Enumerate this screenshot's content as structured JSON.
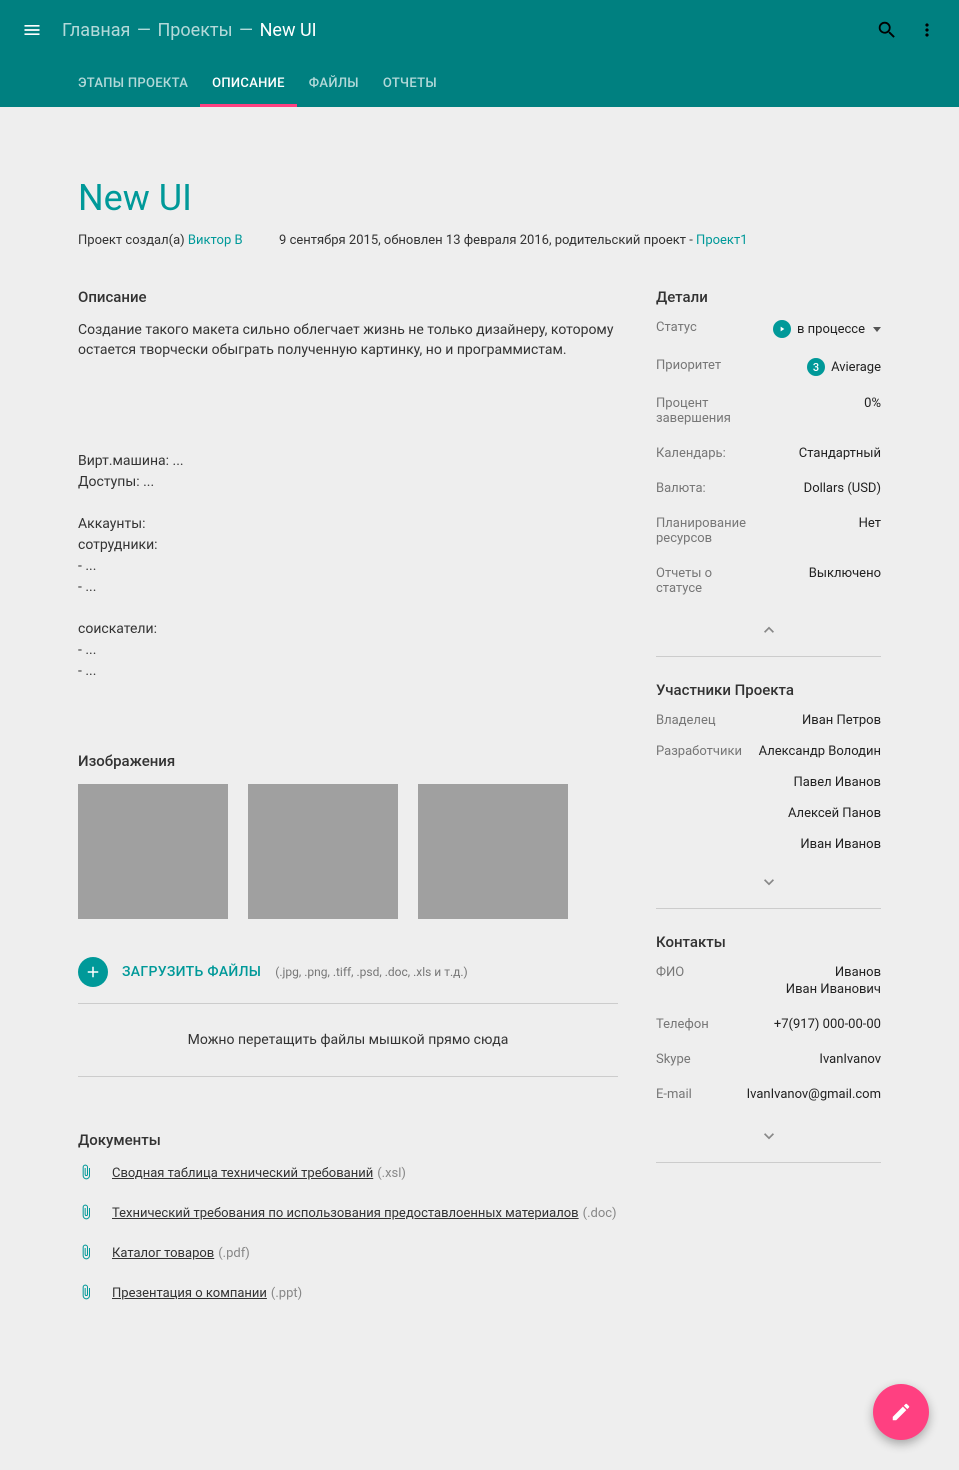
{
  "breadcrumb": {
    "home": "Главная",
    "projects": "Проекты",
    "current": "New UI"
  },
  "tabs": {
    "stages": "ЭТАПЫ ПРОЕКТА",
    "description": "ОПИСАНИЕ",
    "files": "ФАЙЛЫ",
    "reports": "ОТЧЕТЫ"
  },
  "page": {
    "title": "New UI",
    "created_by_label": "Проект создал(а) ",
    "creator": "Виктор В",
    "dates": "9 сентября 2015, обновлен 13 февраля 2016, родительский проект - ",
    "parent_project": "Проект1"
  },
  "description": {
    "heading": "Описание",
    "text": "Создание такого макета сильно облегчает жизнь не только дизайнеру, которому остается творчески обыграть полученную картинку, но и программистам.",
    "block": "Вирт.машина: ...\nДоступы: ...\n\nАккаунты:\nсотрудники:\n- ...\n- ...\n\nсоискатели:\n- ...\n- ..."
  },
  "images": {
    "heading": "Изображения"
  },
  "upload": {
    "label": "ЗАГРУЗИТЬ ФАЙЛЫ",
    "hint": "(.jpg, .png, .tiff, .psd, .doc, .xls и т.д.)",
    "dropzone": "Можно перетащить файлы мышкой прямо сюда"
  },
  "documents": {
    "heading": "Документы",
    "items": [
      {
        "name": "Сводная таблица технический требований",
        "ext": "(.xsl)"
      },
      {
        "name": "Технический требования по использования  предоставлоенных материалов",
        "ext": "(.doc)"
      },
      {
        "name": "Каталог товаров",
        "ext": "(.pdf)"
      },
      {
        "name": "Презентация о компании",
        "ext": "(.ppt)"
      }
    ]
  },
  "details": {
    "heading": "Детали",
    "status_label": "Статус",
    "status_value": "в процессе",
    "priority_label": "Приоритет",
    "priority_badge": "3",
    "priority_value": "Avierage",
    "percent_label": "Процент завершения",
    "percent_value": "0%",
    "calendar_label": "Календарь:",
    "calendar_value": "Стандартный",
    "currency_label": "Валюта:",
    "currency_value": "Dollars (USD)",
    "planning_label": "Планирование ресурсов",
    "planning_value": "Нет",
    "reports_label": "Отчеты о статусе",
    "reports_value": "Выключено"
  },
  "members": {
    "heading": "Участники Проекта",
    "owner_label": "Владелец",
    "owner_value": "Иван Петров",
    "devs_label": "Разработчики",
    "devs": [
      "Александр Володин",
      "Павел Иванов",
      "Алексей Панов",
      "Иван Иванов"
    ]
  },
  "contacts": {
    "heading": "Контакты",
    "fio_label": "ФИО",
    "fio_value1": "Иванов",
    "fio_value2": "Иван Иванович",
    "phone_label": "Телефон",
    "phone_value": "+7(917) 000-00-00",
    "skype_label": "Skype",
    "skype_value": "IvanIvanov",
    "email_label": "E-mail",
    "email_value": "IvanIvanov@gmail.com"
  }
}
